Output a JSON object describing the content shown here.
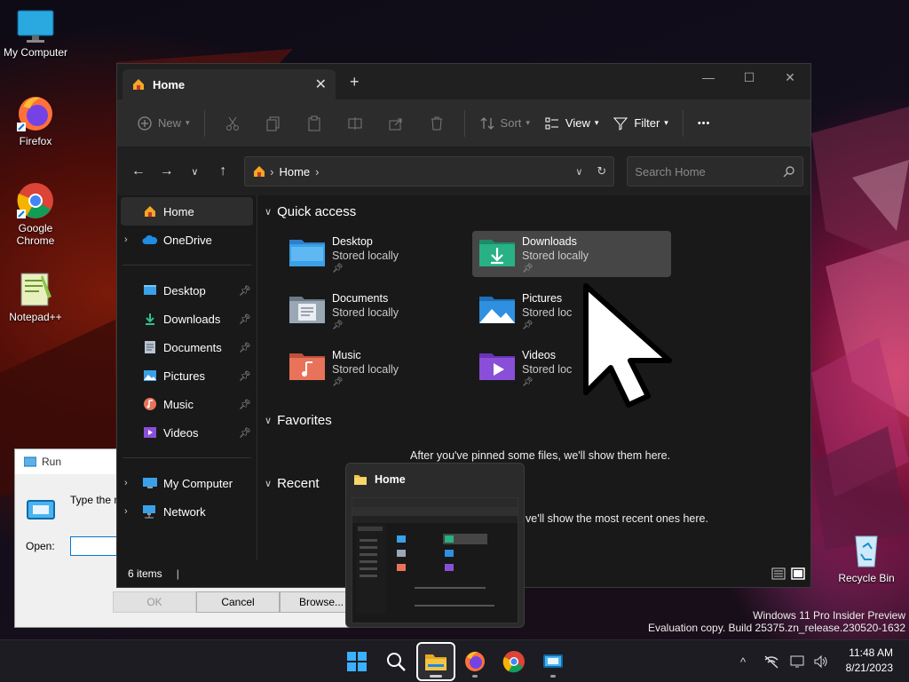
{
  "colors": {
    "accent": "#0078d4",
    "folder_yellow": "#f4c542",
    "window_bg": "#191919",
    "command_bar_bg": "#2c2c2c"
  },
  "desktop": {
    "icons": [
      {
        "label": "My Computer",
        "icon": "monitor-icon"
      },
      {
        "label": "Firefox",
        "icon": "firefox-icon"
      },
      {
        "label": "Google Chrome",
        "icon": "chrome-icon"
      },
      {
        "label": "Notepad++",
        "icon": "notepadpp-icon"
      },
      {
        "label": "Recycle Bin",
        "icon": "recycle-bin-icon"
      }
    ]
  },
  "explorer": {
    "tab_title": "Home",
    "new_tab": "+",
    "window_controls": {
      "minimize": "—",
      "maximize": "☐",
      "close": "✕"
    },
    "toolbar": {
      "new_label": "New",
      "sort_label": "Sort",
      "view_label": "View",
      "filter_label": "Filter",
      "more_label": "•••"
    },
    "address": {
      "crumb": "Home",
      "search_placeholder": "Search Home"
    },
    "nav": {
      "home": "Home",
      "onedrive": "OneDrive",
      "pinned": [
        "Desktop",
        "Downloads",
        "Documents",
        "Pictures",
        "Music",
        "Videos"
      ],
      "my_computer": "My Computer",
      "network": "Network"
    },
    "sections": {
      "quick_access": "Quick access",
      "favorites": "Favorites",
      "recent": "Recent"
    },
    "quick_access_items": [
      {
        "name": "Desktop",
        "status": "Stored locally",
        "icon": "desktop-folder-icon"
      },
      {
        "name": "Downloads",
        "status": "Stored locally",
        "icon": "downloads-folder-icon",
        "highlighted": true
      },
      {
        "name": "Documents",
        "status": "Stored locally",
        "icon": "documents-folder-icon"
      },
      {
        "name": "Pictures",
        "status": "Stored loc",
        "icon": "pictures-folder-icon"
      },
      {
        "name": "Music",
        "status": "Stored locally",
        "icon": "music-folder-icon"
      },
      {
        "name": "Videos",
        "status": "Stored loc",
        "icon": "videos-folder-icon"
      }
    ],
    "favorites_empty": "After you've pinned some files, we'll show them here.",
    "recent_empty": "ve'll show the most recent ones here.",
    "status": {
      "items": "6 items",
      "cursor": "|"
    }
  },
  "run_dialog": {
    "title": "Run",
    "description": "Type the n resource,",
    "open_label": "Open:",
    "input_value": "",
    "ok": "OK",
    "cancel": "Cancel",
    "browse": "Browse..."
  },
  "thumbnail": {
    "title": "Home"
  },
  "watermark": {
    "line1": "Windows 11 Pro Insider Preview",
    "line2": "Evaluation copy. Build 25375.zn_release.230520-1632"
  },
  "taskbar": {
    "apps": [
      "start-icon",
      "search-icon",
      "file-explorer-icon",
      "firefox-icon",
      "chrome-icon",
      "run-icon"
    ],
    "tray": {
      "chevron": "^"
    },
    "time": "11:48 AM",
    "date": "8/21/2023"
  }
}
